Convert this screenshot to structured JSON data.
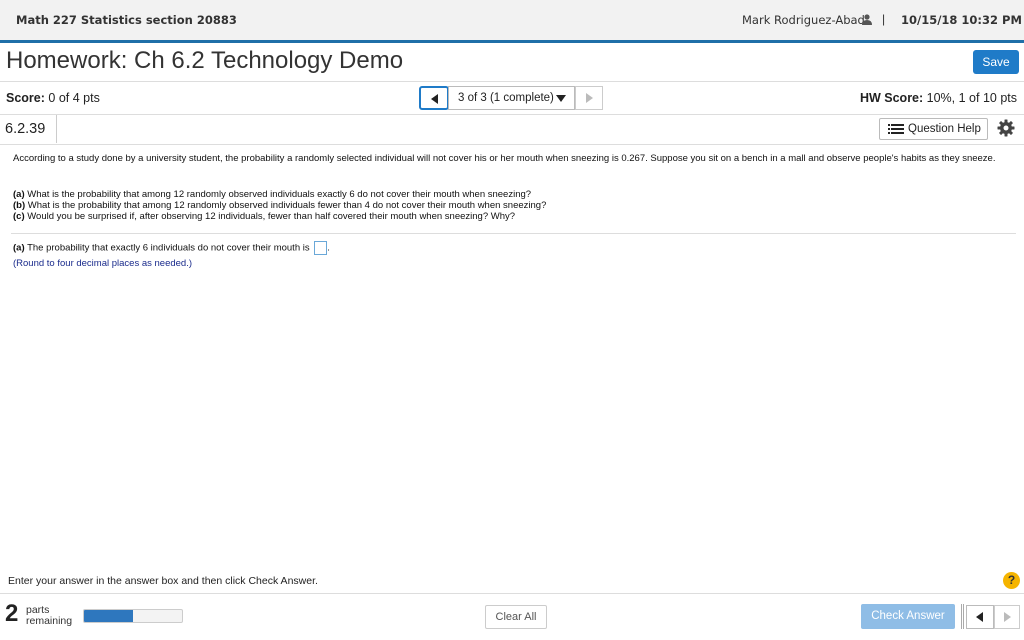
{
  "header": {
    "course": "Math 227 Statistics section 20883",
    "user_name": "Mark Rodriguez-Abad",
    "separator": "|",
    "datetime": "10/15/18 10:32 PM",
    "accent_color": "#1f6fa8"
  },
  "homework": {
    "title": "Homework: Ch 6.2 Technology Demo",
    "save_label": "Save",
    "score_label": "Score:",
    "score_value": "0 of 4 pts",
    "question_position": "3 of 3 (1 complete)",
    "hw_score_label": "HW Score:",
    "hw_score_value": "10%, 1 of 10 pts"
  },
  "question": {
    "number": "6.2.39",
    "help_label": "Question Help",
    "problem_text": "According to a study done by a university student, the probability a randomly selected individual will not cover his or her mouth when sneezing is 0.267. Suppose you sit on a bench in a mall and observe people's habits as they sneeze.",
    "parts": [
      {
        "tag": "(a)",
        "text": " What is the probability that among 12 randomly observed individuals exactly 6 do not cover their mouth when sneezing?"
      },
      {
        "tag": "(b)",
        "text": " What is the probability that among 12 randomly observed individuals fewer than 4 do not cover their mouth when sneezing?"
      },
      {
        "tag": "(c)",
        "text": " Would you be surprised if, after observing 12 individuals, fewer than half covered their mouth when sneezing? Why?"
      }
    ],
    "answer_prompt_tag": "(a)",
    "answer_prompt": " The probability that exactly 6 individuals do not cover their mouth is",
    "answer_suffix": ".",
    "answer_value": "",
    "round_hint": "(Round to four decimal places as needed.)"
  },
  "footer": {
    "instructions": "Enter your answer in the answer box and then click Check Answer.",
    "help_symbol": "?",
    "parts_remaining_count": "2",
    "parts_label_1": "parts",
    "parts_label_2": "remaining",
    "progress_fraction": 0.5,
    "clear_label": "Clear All",
    "check_label": "Check Answer"
  }
}
